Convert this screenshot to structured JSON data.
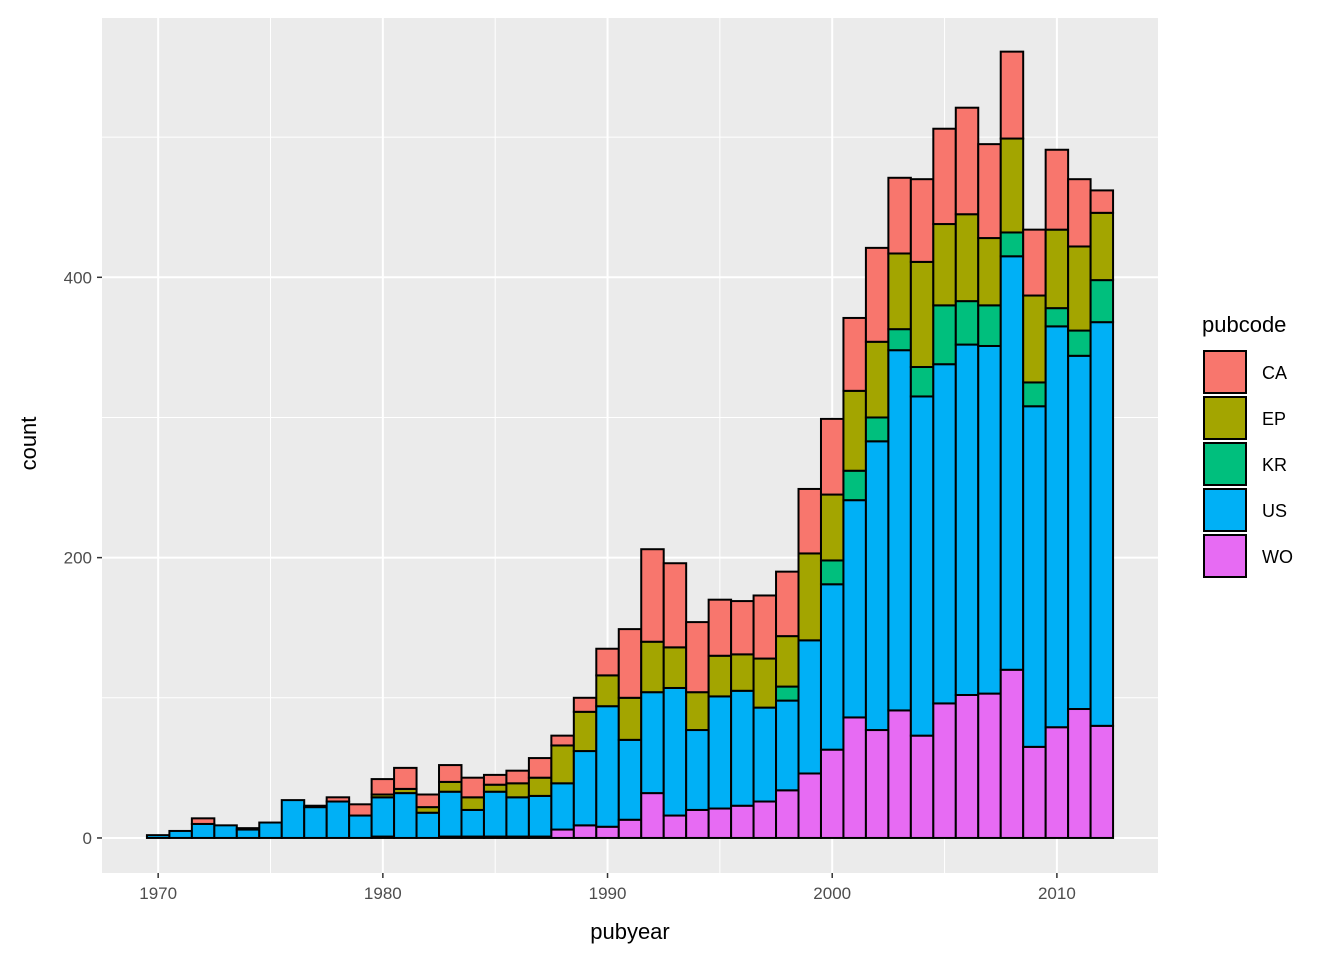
{
  "chart_data": {
    "type": "bar",
    "stacked": true,
    "title": "",
    "xlabel": "pubyear",
    "ylabel": "count",
    "xlim": [
      1967.5,
      2014.5
    ],
    "ylim": [
      -25,
      585
    ],
    "x_ticks": [
      1970,
      1980,
      1990,
      2000,
      2010
    ],
    "y_ticks": [
      0,
      200,
      400
    ],
    "grid": true,
    "legend": {
      "title": "pubcode",
      "position": "right"
    },
    "categories": [
      1970,
      1971,
      1972,
      1973,
      1974,
      1975,
      1976,
      1977,
      1978,
      1979,
      1980,
      1981,
      1982,
      1983,
      1984,
      1985,
      1986,
      1987,
      1988,
      1989,
      1990,
      1991,
      1992,
      1993,
      1994,
      1995,
      1996,
      1997,
      1998,
      1999,
      2000,
      2001,
      2002,
      2003,
      2004,
      2005,
      2006,
      2007,
      2008,
      2009,
      2010,
      2011,
      2012
    ],
    "series": [
      {
        "name": "WO",
        "color": "#E76BF3",
        "values": [
          0,
          0,
          0,
          0,
          0,
          0,
          0,
          0,
          0,
          0,
          1,
          0,
          0,
          1,
          1,
          1,
          1,
          1,
          6,
          9,
          8,
          13,
          32,
          16,
          20,
          21,
          23,
          26,
          34,
          46,
          63,
          86,
          77,
          91,
          73,
          96,
          102,
          103,
          120,
          65,
          79,
          92,
          80
        ]
      },
      {
        "name": "US",
        "color": "#00B0F6",
        "values": [
          2,
          5,
          10,
          9,
          6,
          11,
          27,
          22,
          26,
          16,
          28,
          32,
          18,
          32,
          19,
          32,
          28,
          29,
          33,
          53,
          86,
          57,
          72,
          91,
          57,
          80,
          82,
          67,
          64,
          95,
          118,
          155,
          206,
          257,
          242,
          242,
          250,
          248,
          295,
          243,
          286,
          252,
          288
        ]
      },
      {
        "name": "KR",
        "color": "#00BF7D",
        "values": [
          0,
          0,
          0,
          0,
          0,
          0,
          0,
          0,
          0,
          0,
          0,
          0,
          0,
          0,
          0,
          0,
          0,
          0,
          0,
          0,
          0,
          0,
          0,
          0,
          0,
          0,
          0,
          0,
          10,
          0,
          17,
          21,
          17,
          15,
          21,
          42,
          31,
          29,
          17,
          17,
          13,
          18,
          30
        ]
      },
      {
        "name": "EP",
        "color": "#A3A500",
        "values": [
          0,
          0,
          0,
          0,
          0,
          0,
          0,
          0,
          0,
          0,
          2,
          3,
          4,
          7,
          9,
          5,
          10,
          13,
          27,
          28,
          22,
          30,
          36,
          29,
          27,
          29,
          26,
          35,
          36,
          62,
          47,
          57,
          54,
          54,
          75,
          58,
          62,
          48,
          67,
          62,
          56,
          60,
          48
        ]
      },
      {
        "name": "CA",
        "color": "#F8766D",
        "values": [
          0,
          0,
          4,
          0,
          1,
          0,
          0,
          1,
          3,
          8,
          11,
          15,
          9,
          12,
          14,
          7,
          9,
          14,
          7,
          10,
          19,
          49,
          66,
          60,
          50,
          40,
          38,
          45,
          46,
          46,
          54,
          52,
          67,
          54,
          59,
          68,
          76,
          67,
          62,
          47,
          57,
          48,
          16
        ]
      }
    ]
  },
  "legend_items": [
    {
      "label": "CA",
      "color": "#F8766D"
    },
    {
      "label": "EP",
      "color": "#A3A500"
    },
    {
      "label": "KR",
      "color": "#00BF7D"
    },
    {
      "label": "US",
      "color": "#00B0F6"
    },
    {
      "label": "WO",
      "color": "#E76BF3"
    }
  ],
  "colors": {
    "panel_bg": "#EBEBEB",
    "grid": "#FFFFFF",
    "bar_outline": "#000000"
  }
}
